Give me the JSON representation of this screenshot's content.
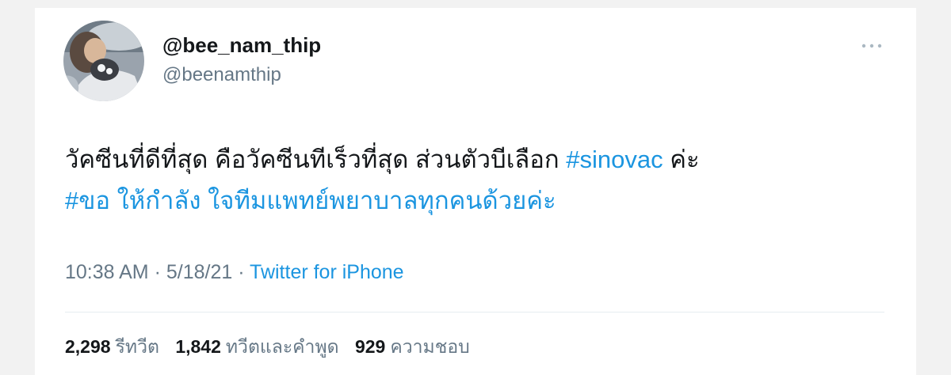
{
  "colors": {
    "text_primary": "#14171a",
    "text_secondary": "#657786",
    "link": "#1b95e0",
    "divider": "#e6ecf0"
  },
  "icons": {
    "more": "more-horizontal-icon"
  },
  "author": {
    "display_name": "@bee_nam_thip",
    "handle": "@beenamthip"
  },
  "tweet": {
    "line1_text": "วัคซีนที่ดีที่สุด คือวัคซีนทีเร็วที่สุด ส่วนตัวบีเลือก ",
    "line1_hashtag": "#sinovac",
    "line1_suffix": " ค่ะ",
    "line2_hashtag": "#ขอ ให้กำลัง ใจทีมแพทย์พยาบาลทุกคนด้วยค่ะ"
  },
  "meta": {
    "time": "10:38 AM",
    "separator1": " · ",
    "date": "5/18/21",
    "separator2": " · ",
    "source": "Twitter for iPhone"
  },
  "stats": {
    "retweets_count": "2,298",
    "retweets_label": "รีทวีต",
    "quotes_count": "1,842",
    "quotes_label": "ทวีตและคำพูด",
    "likes_count": "929",
    "likes_label": "ความชอบ"
  }
}
